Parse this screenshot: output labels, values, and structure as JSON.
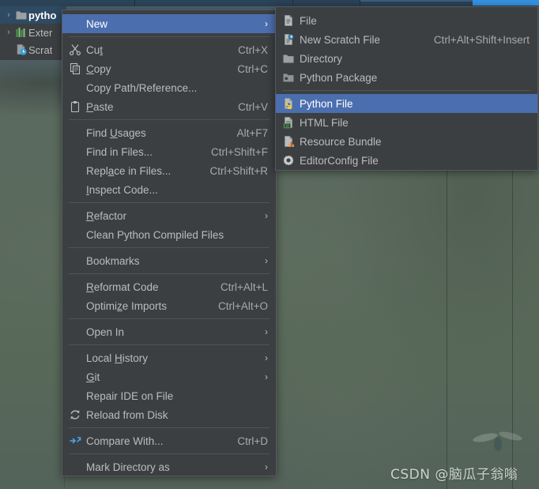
{
  "window": {
    "background_top_color": "#4a6070",
    "background_bottom_color": "#53635a",
    "toolbar_color": "#2b4257",
    "accent_color": "#3592e0"
  },
  "sidebar": {
    "items": [
      {
        "label": "pytho",
        "icon": "folder-icon",
        "twisty": "›",
        "selected": true,
        "indented": false
      },
      {
        "label": "Exter",
        "icon": "external-libraries-icon",
        "twisty": "›",
        "selected": false,
        "indented": false
      },
      {
        "label": "Scrat",
        "icon": "scratches-icon",
        "twisty": "",
        "selected": false,
        "indented": true
      }
    ]
  },
  "context_menu": {
    "name": "project-context-menu",
    "items": [
      {
        "type": "item",
        "label": "New",
        "mnemonic": "",
        "icon": "",
        "accel": "",
        "arrow": true,
        "selected": true,
        "name": "menu-item-new"
      },
      {
        "type": "separator"
      },
      {
        "type": "item",
        "label": "Cut",
        "mnemonic": "t",
        "icon": "scissors-icon",
        "accel": "Ctrl+X",
        "arrow": false,
        "selected": false,
        "name": "menu-item-cut"
      },
      {
        "type": "item",
        "label": "Copy",
        "mnemonic": "C",
        "icon": "copy-icon",
        "accel": "Ctrl+C",
        "arrow": false,
        "selected": false,
        "name": "menu-item-copy"
      },
      {
        "type": "item",
        "label": "Copy Path/Reference...",
        "mnemonic": "",
        "icon": "",
        "accel": "",
        "arrow": false,
        "selected": false,
        "name": "menu-item-copy-path-reference"
      },
      {
        "type": "item",
        "label": "Paste",
        "mnemonic": "P",
        "icon": "clipboard-icon",
        "accel": "Ctrl+V",
        "arrow": false,
        "selected": false,
        "name": "menu-item-paste"
      },
      {
        "type": "separator"
      },
      {
        "type": "item",
        "label": "Find Usages",
        "mnemonic": "U",
        "icon": "",
        "accel": "Alt+F7",
        "arrow": false,
        "selected": false,
        "name": "menu-item-find-usages"
      },
      {
        "type": "item",
        "label": "Find in Files...",
        "mnemonic": "",
        "icon": "",
        "accel": "Ctrl+Shift+F",
        "arrow": false,
        "selected": false,
        "name": "menu-item-find-in-files"
      },
      {
        "type": "item",
        "label": "Replace in Files...",
        "mnemonic": "a",
        "icon": "",
        "accel": "Ctrl+Shift+R",
        "arrow": false,
        "selected": false,
        "name": "menu-item-replace-in-files"
      },
      {
        "type": "item",
        "label": "Inspect Code...",
        "mnemonic": "I",
        "icon": "",
        "accel": "",
        "arrow": false,
        "selected": false,
        "name": "menu-item-inspect-code"
      },
      {
        "type": "separator"
      },
      {
        "type": "item",
        "label": "Refactor",
        "mnemonic": "R",
        "icon": "",
        "accel": "",
        "arrow": true,
        "selected": false,
        "name": "menu-item-refactor"
      },
      {
        "type": "item",
        "label": "Clean Python Compiled Files",
        "mnemonic": "",
        "icon": "",
        "accel": "",
        "arrow": false,
        "selected": false,
        "name": "menu-item-clean-python-compiled-files"
      },
      {
        "type": "separator"
      },
      {
        "type": "item",
        "label": "Bookmarks",
        "mnemonic": "",
        "icon": "",
        "accel": "",
        "arrow": true,
        "selected": false,
        "name": "menu-item-bookmarks"
      },
      {
        "type": "separator"
      },
      {
        "type": "item",
        "label": "Reformat Code",
        "mnemonic": "R",
        "icon": "",
        "accel": "Ctrl+Alt+L",
        "arrow": false,
        "selected": false,
        "name": "menu-item-reformat-code"
      },
      {
        "type": "item",
        "label": "Optimize Imports",
        "mnemonic": "z",
        "icon": "",
        "accel": "Ctrl+Alt+O",
        "arrow": false,
        "selected": false,
        "name": "menu-item-optimize-imports"
      },
      {
        "type": "separator"
      },
      {
        "type": "item",
        "label": "Open In",
        "mnemonic": "",
        "icon": "",
        "accel": "",
        "arrow": true,
        "selected": false,
        "name": "menu-item-open-in"
      },
      {
        "type": "separator"
      },
      {
        "type": "item",
        "label": "Local History",
        "mnemonic": "H",
        "icon": "",
        "accel": "",
        "arrow": true,
        "selected": false,
        "name": "menu-item-local-history"
      },
      {
        "type": "item",
        "label": "Git",
        "mnemonic": "G",
        "icon": "",
        "accel": "",
        "arrow": true,
        "selected": false,
        "name": "menu-item-git"
      },
      {
        "type": "item",
        "label": "Repair IDE on File",
        "mnemonic": "",
        "icon": "",
        "accel": "",
        "arrow": false,
        "selected": false,
        "name": "menu-item-repair-ide-on-file"
      },
      {
        "type": "item",
        "label": "Reload from Disk",
        "mnemonic": "",
        "icon": "reload-icon",
        "accel": "",
        "arrow": false,
        "selected": false,
        "name": "menu-item-reload-from-disk"
      },
      {
        "type": "separator"
      },
      {
        "type": "item",
        "label": "Compare With...",
        "mnemonic": "",
        "icon": "compare-icon",
        "accel": "Ctrl+D",
        "arrow": false,
        "selected": false,
        "name": "menu-item-compare-with"
      },
      {
        "type": "separator"
      },
      {
        "type": "item",
        "label": "Mark Directory as",
        "mnemonic": "",
        "icon": "",
        "accel": "",
        "arrow": true,
        "selected": false,
        "name": "menu-item-mark-directory-as"
      }
    ]
  },
  "new_submenu": {
    "name": "new-submenu",
    "items": [
      {
        "type": "item",
        "label": "File",
        "icon": "file-icon",
        "accel": "",
        "arrow": false,
        "selected": false,
        "name": "submenu-item-file"
      },
      {
        "type": "item",
        "label": "New Scratch File",
        "icon": "scratch-file-icon",
        "accel": "Ctrl+Alt+Shift+Insert",
        "arrow": false,
        "selected": false,
        "name": "submenu-item-new-scratch-file"
      },
      {
        "type": "item",
        "label": "Directory",
        "icon": "folder-icon",
        "accel": "",
        "arrow": false,
        "selected": false,
        "name": "submenu-item-directory"
      },
      {
        "type": "item",
        "label": "Python Package",
        "icon": "python-package-icon",
        "accel": "",
        "arrow": false,
        "selected": false,
        "name": "submenu-item-python-package"
      },
      {
        "type": "separator"
      },
      {
        "type": "item",
        "label": "Python File",
        "icon": "python-file-icon",
        "accel": "",
        "arrow": false,
        "selected": true,
        "name": "submenu-item-python-file"
      },
      {
        "type": "item",
        "label": "HTML File",
        "icon": "html-file-icon",
        "accel": "",
        "arrow": false,
        "selected": false,
        "name": "submenu-item-html-file"
      },
      {
        "type": "item",
        "label": "Resource Bundle",
        "icon": "resource-bundle-icon",
        "accel": "",
        "arrow": false,
        "selected": false,
        "name": "submenu-item-resource-bundle"
      },
      {
        "type": "item",
        "label": "EditorConfig File",
        "icon": "editorconfig-icon",
        "accel": "",
        "arrow": false,
        "selected": false,
        "name": "submenu-item-editorconfig-file"
      }
    ]
  },
  "watermark": {
    "text": "CSDN @脑瓜子翁嗡"
  },
  "glyphs": {
    "arrow_right": "›"
  }
}
